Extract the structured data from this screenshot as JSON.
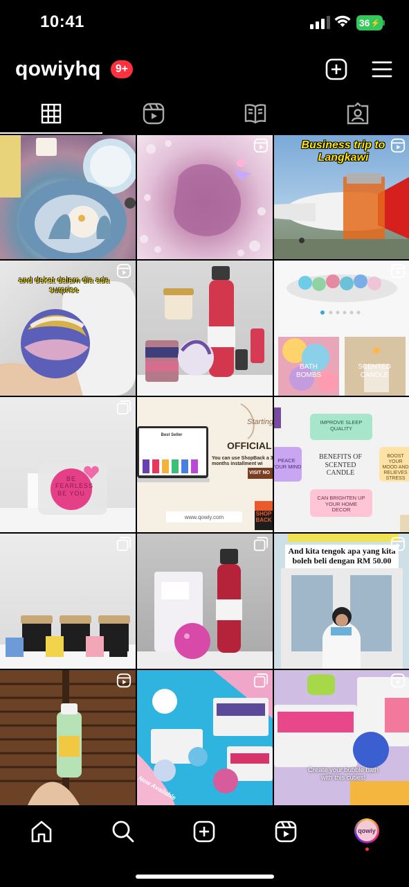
{
  "status_bar": {
    "time": "10:41",
    "battery": "36"
  },
  "header": {
    "username": "qowiyhq",
    "notifications": "9+"
  },
  "tabs": [
    {
      "name": "grid",
      "icon": "grid-icon",
      "active": true
    },
    {
      "name": "reels",
      "icon": "reels-icon",
      "active": false
    },
    {
      "name": "guides",
      "icon": "guides-icon",
      "active": false
    },
    {
      "name": "tagged",
      "icon": "tagged-icon",
      "active": false
    }
  ],
  "posts": {
    "p2_1_caption": "and dekat dalam dia ada surprise",
    "p1_3_caption": "Business trip to Langkawi",
    "p2_3_label1": "BATH BOMBS",
    "p2_3_label2": "SCENTED CANDLE",
    "p3_1_text": "BE FEARLESS BE YOU",
    "p3_2_title": "OFFICIAL W",
    "p3_2_sub": "Starting",
    "p3_2_body": "You can use ShopBack a 3x months installment wi",
    "p3_2_visit": "VISIT NO",
    "p3_2_url": "www.qowiy.com",
    "p3_2_bestseller": "Best Seller",
    "p3_2_shop": "SHOP BACK",
    "p3_3_center": "BENEFITS OF SCENTED CANDLE",
    "p3_3_top": "IMPROVE SLEEP QUALITY",
    "p3_3_left": "PEACE YOUR MIND",
    "p3_3_right": "BOOST YOUR MOOD AND RELIEVES STRESS",
    "p3_3_bottom": "CAN BRIGHTEN UP YOUR HOME DECOR",
    "p4_3_caption": "And kita tengok apa yang kita boleh beli dengan RM 50.00",
    "p5_3_caption": "Create your bubble bath with this cuties!",
    "p5_2_caption": "Now Available"
  },
  "nav": [
    "home-icon",
    "search-icon",
    "create-icon",
    "reels-icon",
    "profile-avatar"
  ],
  "avatar_text": "qowiy"
}
